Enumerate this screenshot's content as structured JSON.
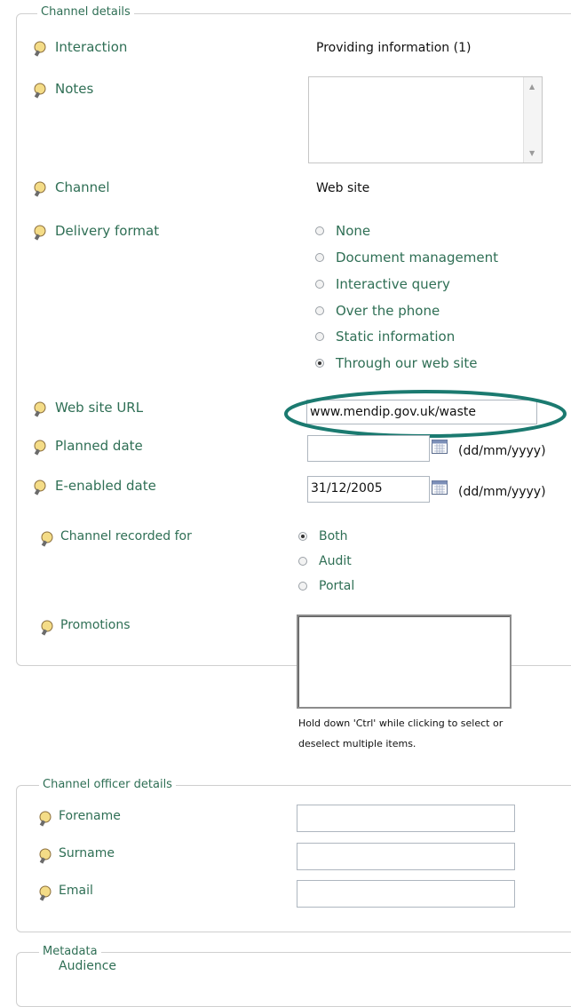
{
  "channel_details": {
    "legend": "Channel details",
    "interaction": {
      "label": "Interaction",
      "value": "Providing information (1)"
    },
    "notes": {
      "label": "Notes",
      "value": ""
    },
    "channel": {
      "label": "Channel",
      "value": "Web site"
    },
    "delivery_format": {
      "label": "Delivery format",
      "options": [
        "None",
        "Document management",
        "Interactive query",
        "Over the phone",
        "Static information",
        "Through our web site"
      ],
      "selected": "Through our web site"
    },
    "web_site_url": {
      "label": "Web site URL",
      "value": "www.mendip.gov.uk/waste"
    },
    "planned_date": {
      "label": "Planned date",
      "value": "",
      "format": "(dd/mm/yyyy)"
    },
    "e_enabled_date": {
      "label": "E-enabled date",
      "value": "31/12/2005",
      "format": "(dd/mm/yyyy)"
    },
    "channel_recorded_for": {
      "label": "Channel recorded for",
      "options": [
        "Both",
        "Audit",
        "Portal"
      ],
      "selected": "Both"
    },
    "promotions": {
      "label": "Promotions",
      "hint_line1": "Hold down 'Ctrl' while clicking to select or",
      "hint_line2": "deselect multiple items."
    }
  },
  "officer_details": {
    "legend": "Channel officer details",
    "forename": {
      "label": "Forename",
      "value": ""
    },
    "surname": {
      "label": "Surname",
      "value": ""
    },
    "email": {
      "label": "Email",
      "value": ""
    }
  },
  "metadata": {
    "legend": "Metadata",
    "audience_label": "Audience"
  },
  "colors": {
    "label_green": "#2f6f55",
    "highlight_ellipse": "#1b7a70",
    "border": "#cfcfcf"
  },
  "icons": {
    "field_help": "lightbulb-icon",
    "date_picker": "calendar-icon"
  }
}
